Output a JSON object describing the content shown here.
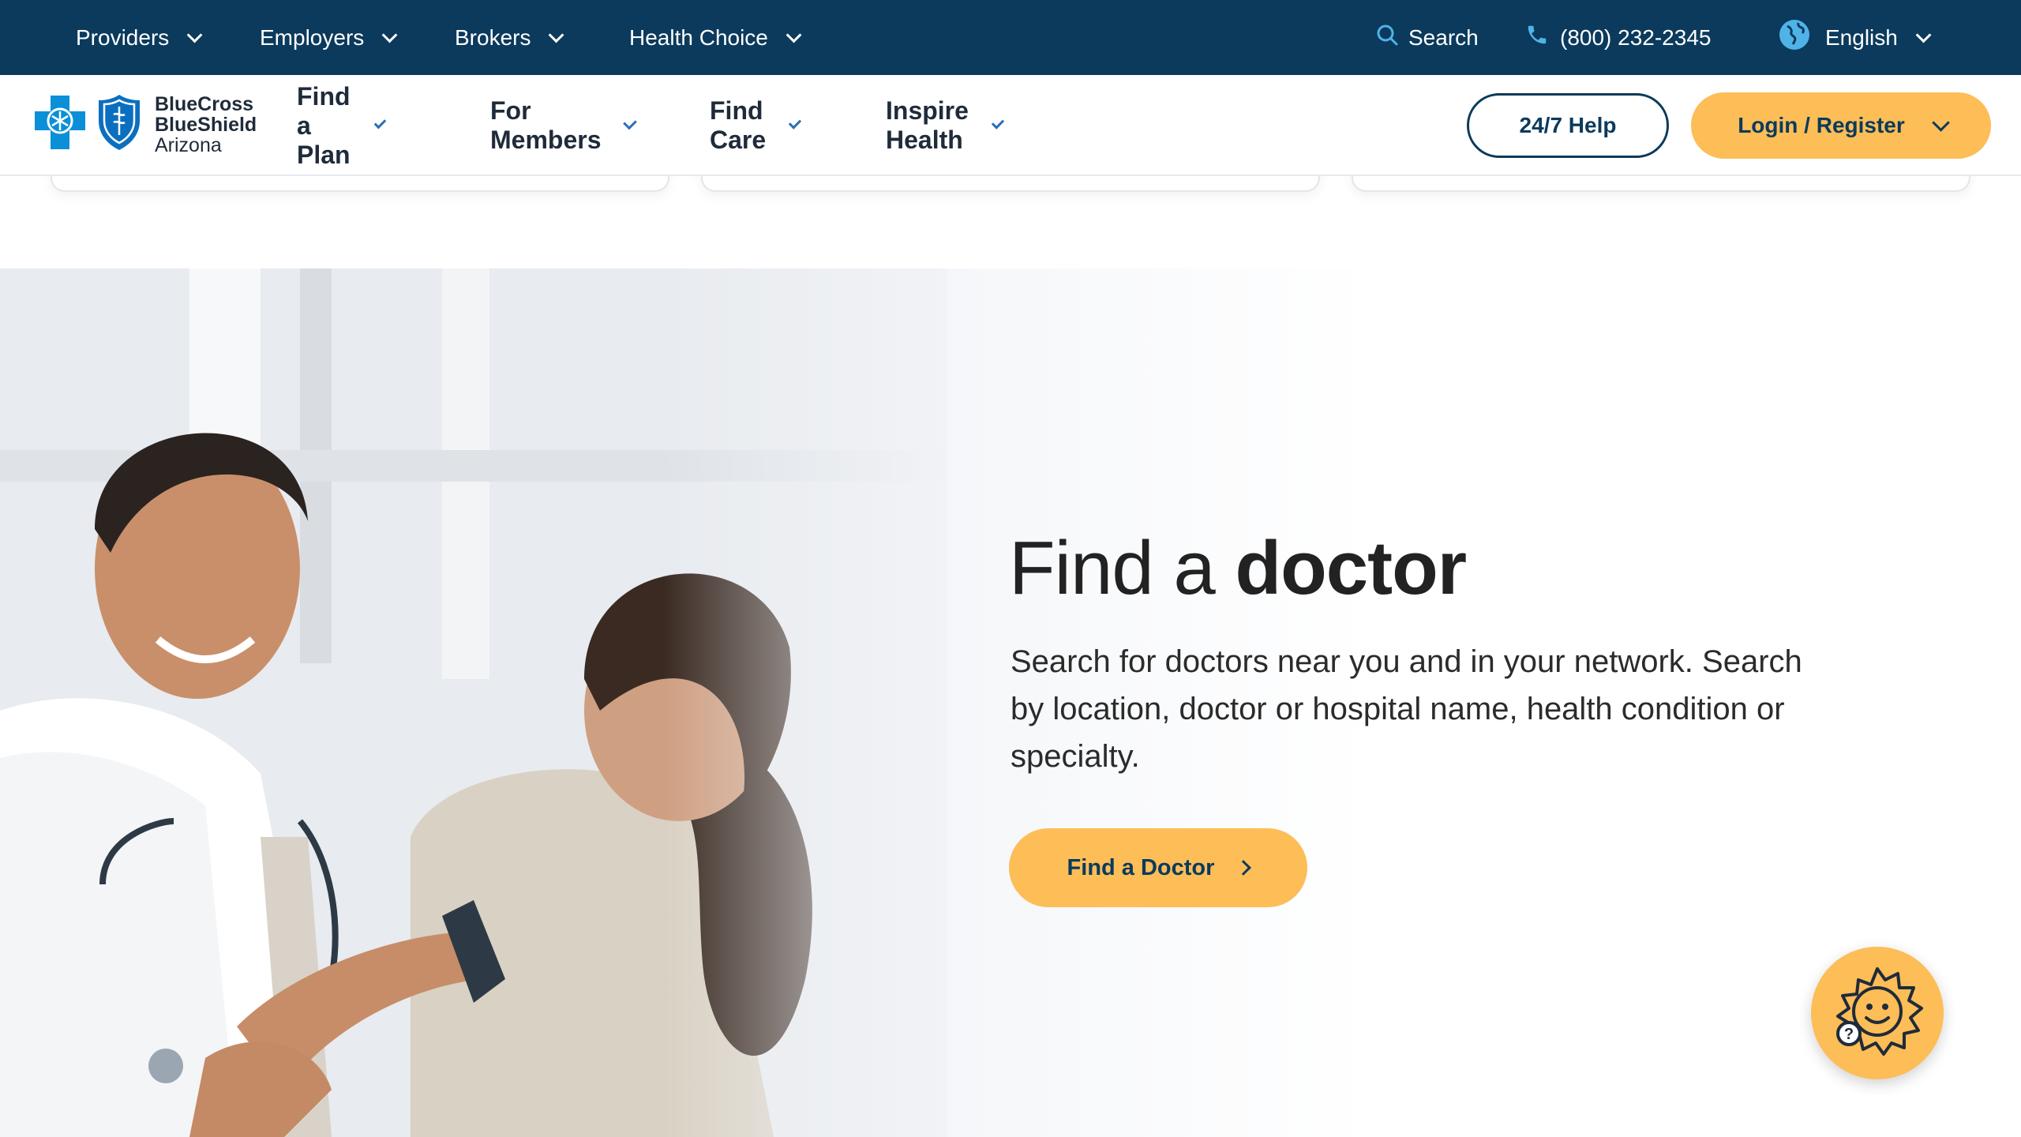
{
  "topbar": {
    "items": [
      {
        "label": "Providers"
      },
      {
        "label": "Employers"
      },
      {
        "label": "Brokers"
      },
      {
        "label": "Health Choice"
      }
    ],
    "search_label": "Search",
    "phone": "(800) 232-2345",
    "language": "English"
  },
  "brand": {
    "line1": "BlueCross",
    "line2": "BlueShield",
    "line3": "Arizona"
  },
  "nav": {
    "items": [
      {
        "label": "Find a Plan"
      },
      {
        "label": "For Members"
      },
      {
        "label": "Find Care"
      },
      {
        "label": "Inspire Health"
      }
    ],
    "help_label": "24/7 Help",
    "login_label": "Login / Register"
  },
  "hero": {
    "title_light": "Find a ",
    "title_bold": "doctor",
    "description": "Search for doctors near you and in your network. Search by location, doctor or hospital name, health condition or specialty.",
    "cta_label": "Find a Doctor"
  },
  "colors": {
    "topbar": "#0b3a5c",
    "accent": "#fdbd57",
    "link_blue": "#2a6fb4"
  }
}
